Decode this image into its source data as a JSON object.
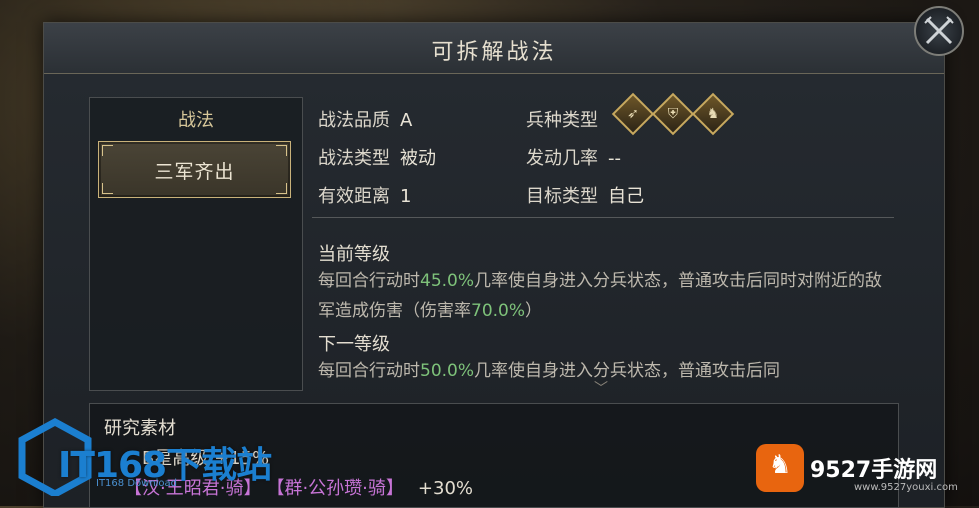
{
  "window": {
    "title": "可拆解战法"
  },
  "skill_list": {
    "header": "战法",
    "items": [
      {
        "label": "三军齐出",
        "selected": true
      }
    ]
  },
  "details": {
    "quality_label": "战法品质",
    "quality_value": "A",
    "type_label": "战法类型",
    "type_value": "被动",
    "range_label": "有效距离",
    "range_value": "1",
    "troop_label": "兵种类型",
    "troop_icons": [
      "archer-icon",
      "shield-icon",
      "cavalry-icon"
    ],
    "trigger_label": "发动几率",
    "trigger_value": "--",
    "target_label": "目标类型",
    "target_value": "自己"
  },
  "current_level": {
    "title": "当前等级",
    "text_a": "每回合行动时",
    "rate": "45.0%",
    "text_b": "几率使自身进入分兵状态，普通攻击后同时对附近的敌军造成伤害（伤害率",
    "damage": "70.0%",
    "text_c": "）"
  },
  "next_level": {
    "title": "下一等级",
    "text_a": "每回合行动时",
    "rate": "50.0%",
    "text_b": "几率使自身进入分兵状态，普通攻击后同"
  },
  "materials": {
    "title": "研究素材",
    "line1": "B星高级 +15%",
    "tag1": "【汉·王昭君·骑】",
    "tag2": "【群·公孙瓒·骑】",
    "bonus": "+30%"
  },
  "watermarks": {
    "left_brand": "IT168下载站",
    "left_sub": "IT168 Download",
    "right_brand": "9527手游网",
    "right_sub": "www.9527youxi.com"
  },
  "colors": {
    "highlight": "#7ec27a",
    "tag": "#c774d6",
    "gold": "#d8c89a"
  }
}
